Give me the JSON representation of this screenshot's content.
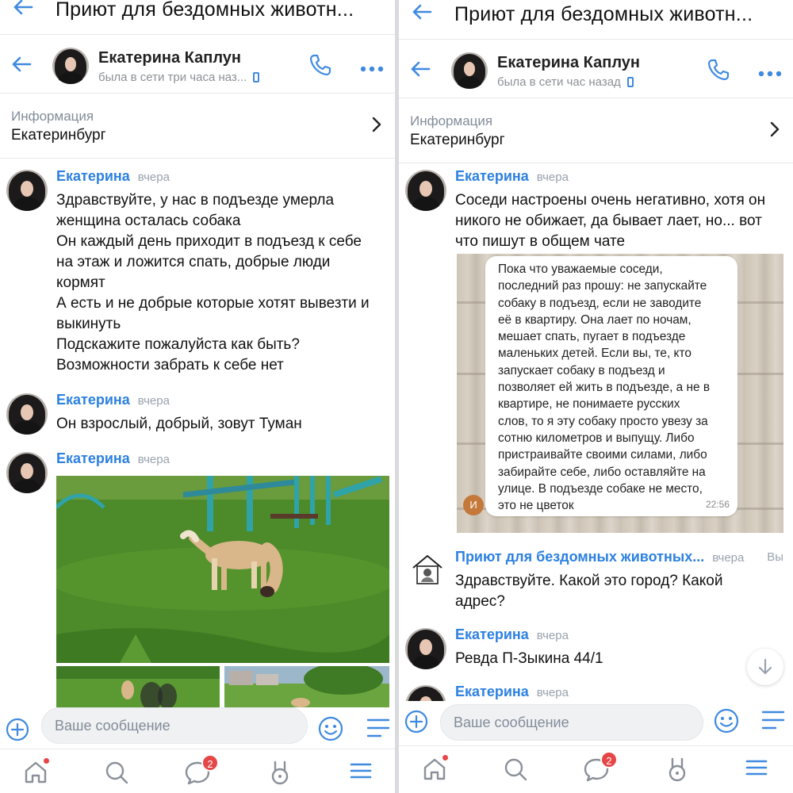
{
  "left": {
    "topbar_title": "Приют для бездомных животн...",
    "contact": {
      "name": "Екатерина Каплун",
      "status": "была в сети три часа наз..."
    },
    "info": {
      "label": "Информация",
      "value": "Екатеринбург"
    },
    "messages": [
      {
        "author": "Екатерина",
        "time": "вчера",
        "text": "Здравствуйте, у нас в подъезде умерла\nженщина осталась собака\nОн каждый день приходит в подъезд к себе\nна этаж и ложится спать, добрые люди\nкормят\nА есть и не добрые которые хотят вывезти и\nвыкинуть\nПодскажите пожалуйста как быть?\nВозможности забрать к себе нет"
      },
      {
        "author": "Екатерина",
        "time": "вчера",
        "text": "Он взрослый, добрый, зовут Туман"
      },
      {
        "author": "Екатерина",
        "time": "вчера",
        "attachment": "photo-dog-on-grass"
      }
    ],
    "composer_placeholder": "Ваше сообщение",
    "tabbar": {
      "messages_badge": "2"
    }
  },
  "right": {
    "topbar_title": "Приют для бездомных животн...",
    "contact": {
      "name": "Екатерина Каплун",
      "status": "была в сети час назад"
    },
    "info": {
      "label": "Информация",
      "value": "Екатеринбург"
    },
    "messages": [
      {
        "author": "Екатерина",
        "time": "вчера",
        "text": "Соседи настроены очень негативно, хотя он\nникого не обижает, да бывает лает, но... вот\nчто пишут в общем чате",
        "screenshot": {
          "sender_initial": "И",
          "time": "22:56",
          "text": "Пока что уважаемые соседи,\nпоследний раз прошу: не запускайте\nсобаку в подъезд, если не заводите\nеё в квартиру. Она лает по ночам,\nмешает спать, пугает в подъезде\nмаленьких детей. Если вы, те, кто\nзапускает собаку в подъезд и\nпозволяет ей жить в подъезде, а не в\nквартире, не понимаете русских\nслов, то я эту собаку просто увезу за\nсотню километров и выпущу. Либо\nпристраивайте своими силами, либо\nзабирайте себе, либо оставляйте на\nулице. В подъезде собаке не место,\nэто не цветок"
        }
      },
      {
        "author": "Приют для бездомных животных...",
        "time": "вчера",
        "you": "Вы",
        "text": "Здравствуйте. Какой это город? Какой\nадрес?"
      },
      {
        "author": "Екатерина",
        "time": "вчера",
        "text": "Ревда П-Зыкина 44/1"
      },
      {
        "author": "Екатерина",
        "time": "вчера",
        "text": ""
      }
    ],
    "composer_placeholder": "Ваше сообщение",
    "tabbar": {
      "messages_badge": "2"
    }
  },
  "colors": {
    "accent": "#3f8ae0",
    "author": "#2d81e0",
    "badge": "#e64646"
  },
  "icons": [
    "back-arrow-icon",
    "phone-icon",
    "more-icon",
    "chevron-right-icon",
    "plus-circle-icon",
    "smile-icon",
    "menu-lines-icon",
    "home-icon",
    "search-icon",
    "chat-icon",
    "clips-icon",
    "hamburger-icon",
    "arrow-down-icon"
  ]
}
